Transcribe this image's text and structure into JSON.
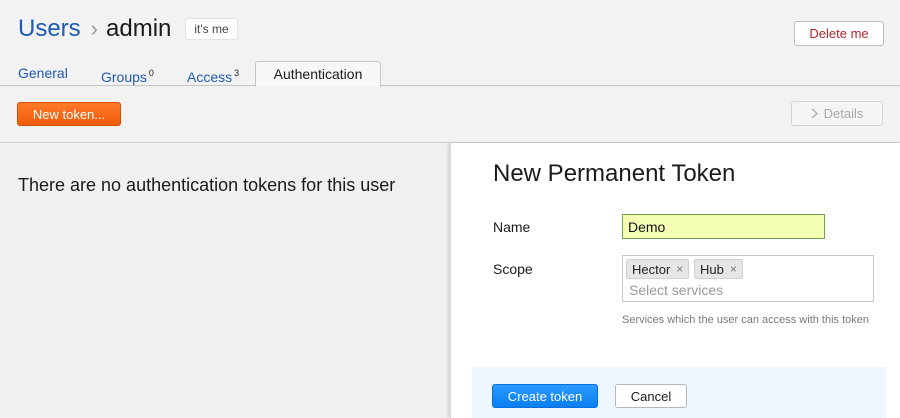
{
  "breadcrumb": {
    "root": "Users",
    "separator": "›",
    "current": "admin",
    "badge": "it's me"
  },
  "header": {
    "delete_label": "Delete me"
  },
  "tabs": [
    {
      "label": "General",
      "count": ""
    },
    {
      "label": "Groups",
      "count": "0"
    },
    {
      "label": "Access",
      "count": "3"
    },
    {
      "label": "Authentication",
      "count": "",
      "active": true
    }
  ],
  "toolbar": {
    "new_token_label": "New token...",
    "details_label": "Details",
    "details_icon": "chevron-right-icon"
  },
  "main": {
    "empty_message": "There are no authentication tokens for this user"
  },
  "panel": {
    "title": "New Permanent Token",
    "name_label": "Name",
    "name_value": "Demo",
    "scope_label": "Scope",
    "scope_chips": [
      {
        "label": "Hector"
      },
      {
        "label": "Hub"
      }
    ],
    "scope_remove_glyph": "×",
    "scope_placeholder": "Select services",
    "hint": "Services which the user can access with this token",
    "create_label": "Create token",
    "cancel_label": "Cancel"
  },
  "colors": {
    "link": "#1f5ab6",
    "accent_orange": "#f05a0a",
    "primary_blue": "#0a7ef2",
    "danger": "#b0242c"
  }
}
